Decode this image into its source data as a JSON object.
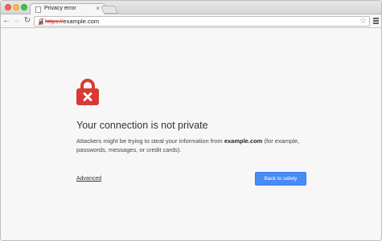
{
  "browser": {
    "tab": {
      "title": "Privacy error",
      "close_glyph": "×",
      "favicon": "page-icon"
    },
    "toolbar": {
      "back_glyph": "←",
      "forward_glyph": "→",
      "reload_glyph": "↻",
      "url_scheme": "https://",
      "url_host": "example.com",
      "security_icon": "broken-lock-icon",
      "star_glyph": "☆",
      "menu_icon": "hamburger-menu-icon"
    }
  },
  "interstitial": {
    "icon": "red-lock-x-icon",
    "heading": "Your connection is not private",
    "body_prefix": "Attackers might be trying to steal your information from ",
    "body_host": "example.com",
    "body_suffix": " (for example, passwords, messages, or credit cards).",
    "advanced_label": "Advanced",
    "safety_button_label": "Back to safety"
  },
  "colors": {
    "accent_button": "#4a8af4",
    "lock_red": "#d93a33",
    "page_background": "#f7f7f7",
    "insecure_scheme": "#c5221f"
  }
}
